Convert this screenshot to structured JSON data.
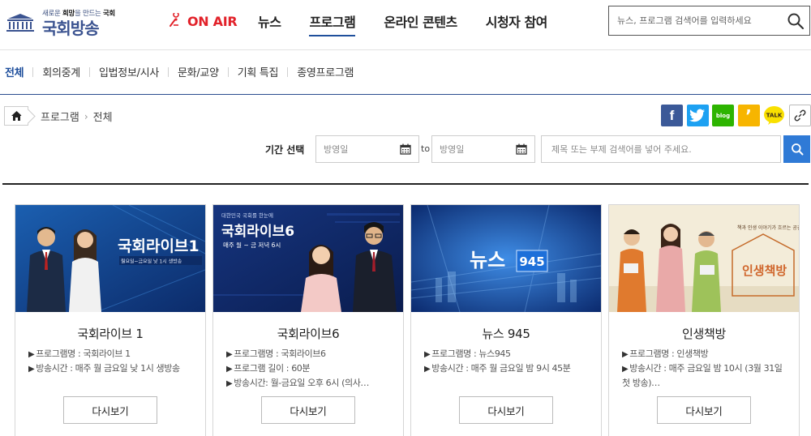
{
  "header": {
    "logo": {
      "tagline_prefix": "새로운 ",
      "tagline_emph": "희망",
      "tagline_mid": "을 만드는 ",
      "tagline_tail": "국회",
      "name": "국회방송"
    },
    "onair_label": "ON AIR",
    "nav": [
      "뉴스",
      "프로그램",
      "온라인 콘텐츠",
      "시청자 참여"
    ],
    "active_nav": "프로그램",
    "search_placeholder": "뉴스, 프로그램 검색어를 입력하세요"
  },
  "tabs": {
    "items": [
      "전체",
      "회의중계",
      "입법정보/시사",
      "문화/교양",
      "기획 특집",
      "종영프로그램"
    ],
    "active": "전체"
  },
  "breadcrumb": [
    "프로그램",
    "전체"
  ],
  "share": {
    "icons": [
      "facebook-icon",
      "twitter-icon",
      "naver-blog-icon",
      "kakao-story-icon",
      "kakao-talk-icon",
      "link-icon"
    ],
    "blog_text": "blog",
    "story_text": "’",
    "talk_text": "TALK",
    "fb_text": "f"
  },
  "filter": {
    "label": "기간 선택",
    "start_placeholder": "방영일",
    "to_label": "to",
    "end_placeholder": "방영일",
    "keyword_placeholder": "제목 또는 부제 검색어를 넣어 주세요."
  },
  "programs": [
    {
      "title": "국회라이브 1",
      "thumb_text": "국회라이브1",
      "thumb_sub": "월요일~금요일 낮 1시 생방송",
      "info": [
        "프로그램명 : 국회라이브 1",
        "방송시간 : 매주 월 금요일 낮 1시 생방송"
      ],
      "button": "다시보기"
    },
    {
      "title": "국회라이브6",
      "thumb_text": "국회라이브6",
      "thumb_top": "대한민국 국회를 한눈에",
      "thumb_sub": "매주 월 ~ 금 저녁 6시",
      "info": [
        "프로그램명 : 국회라이브6",
        "프로그램 길이 : 60분",
        "방송시간: 월-금요일 오후 6시 (의사…"
      ],
      "button": "다시보기"
    },
    {
      "title": "뉴스 945",
      "thumb_text": "뉴스",
      "thumb_badge": "945",
      "info": [
        "프로그램명 : 뉴스945",
        "방송시간 : 매주 월 금요일 밤 9시 45분"
      ],
      "button": "다시보기"
    },
    {
      "title": "인생책방",
      "thumb_text": "인생책방",
      "thumb_top": "책과 인생 이야기가 흐르는 공간",
      "info": [
        "프로그램명 : 인생책방",
        "방송시간 : 매주 금요일 밤 10시 (3월 31일 첫 방송)…"
      ],
      "button": "다시보기"
    }
  ],
  "colors": {
    "brand_blue": "#1f4f9c",
    "onair_red": "#e2222a",
    "search_blue": "#2f7ad6"
  }
}
